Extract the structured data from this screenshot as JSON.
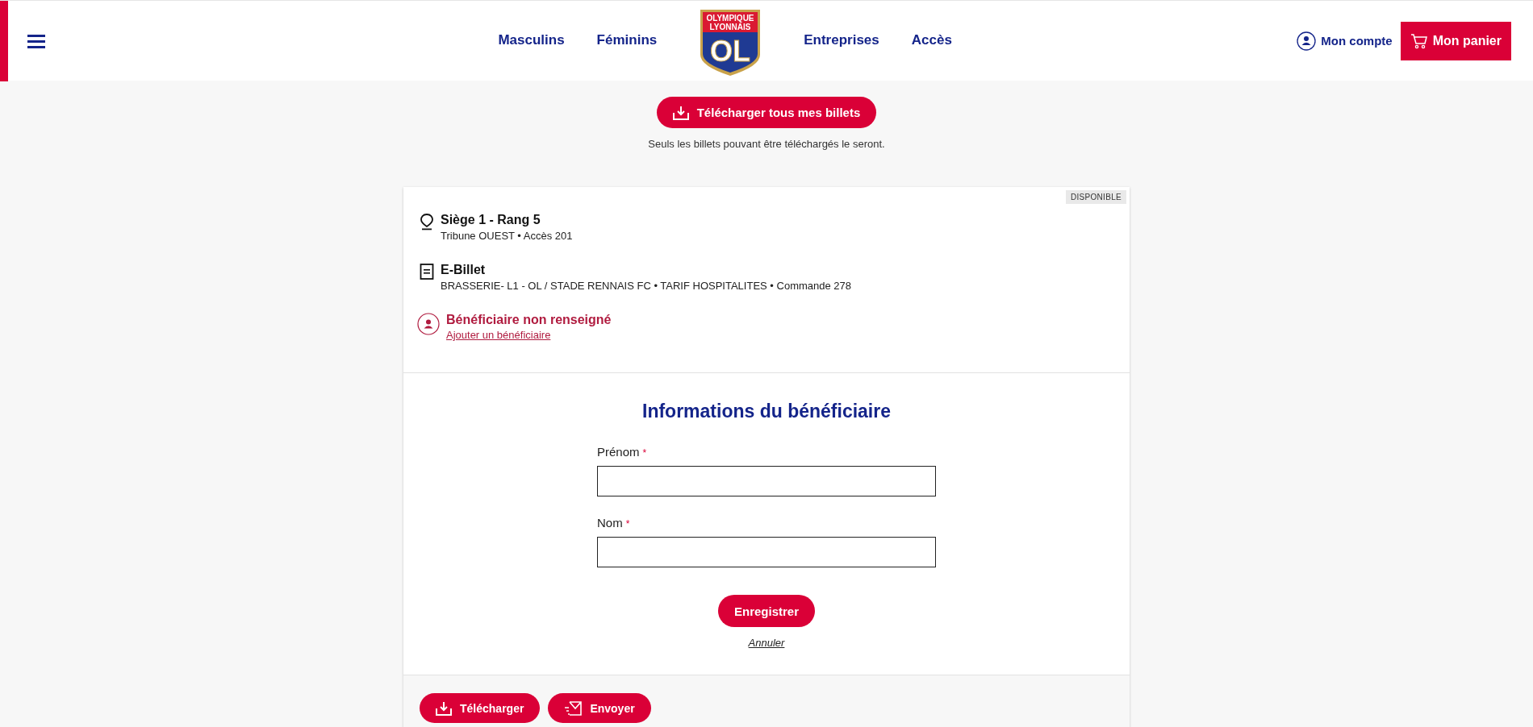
{
  "header": {
    "nav_left": [
      "Masculins",
      "Féminins"
    ],
    "logo": {
      "line_1": "OLYMPIQUE",
      "line_2": "LYONNAIS",
      "initials": "OL"
    },
    "nav_right": [
      "Entreprises",
      "Accès"
    ],
    "account": "Mon compte",
    "cart": "Mon panier"
  },
  "download_all": {
    "label": "Télécharger tous mes billets",
    "note": "Seuls les billets pouvant être téléchargés le seront."
  },
  "ticket": {
    "status": "DISPONIBLE",
    "details": [
      {
        "kind": "seat",
        "title": "Siège 1 - Rang 5",
        "subtitle": "Tribune OUEST • Accès 201"
      },
      {
        "kind": "ticket",
        "title": "E-Billet",
        "subtitle": "BRASSERIE- L1 - OL / STADE RENNAIS FC • TARIF HOSPITALITES • Commande 278"
      }
    ],
    "beneficiary": {
      "title": "Bénéficiaire non renseigné",
      "link": "Ajouter un bénéficiaire"
    },
    "form": {
      "title": "Informations du bénéficiaire",
      "fields": [
        {
          "label": "Prénom",
          "required_mark": "*"
        },
        {
          "label": "Nom",
          "required_mark": "*"
        }
      ],
      "submit": "Enregistrer",
      "cancel": "Annuler"
    },
    "actions": [
      {
        "kind": "download",
        "label": "Télécharger"
      },
      {
        "kind": "send",
        "label": "Envoyer"
      }
    ]
  }
}
